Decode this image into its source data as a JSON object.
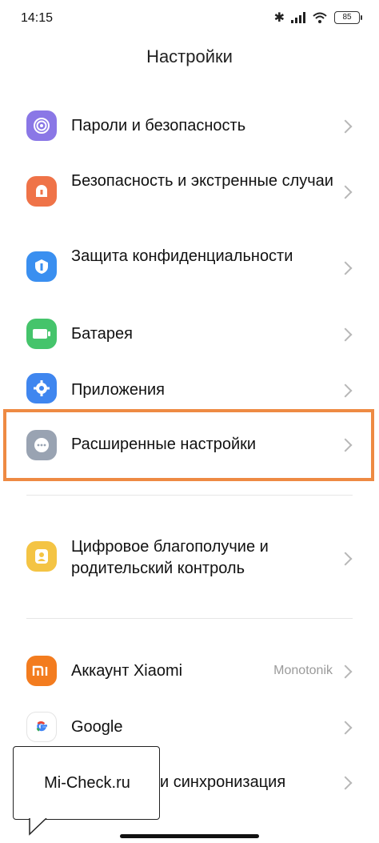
{
  "status_bar": {
    "time": "14:15",
    "battery": "85"
  },
  "title": "Настройки",
  "items": [
    {
      "label": "Пароли и безопасность",
      "icon": "fingerprint-icon",
      "color": "#8a77e6"
    },
    {
      "label": "Безопасность и экстренные случаи",
      "icon": "emergency-icon",
      "color": "#ef7348"
    },
    {
      "label": "Защита конфиденциальности",
      "icon": "privacy-shield-icon",
      "color": "#3a8ff0"
    },
    {
      "label": "Батарея",
      "icon": "battery-icon",
      "color": "#45c46b"
    },
    {
      "label": "Приложения",
      "icon": "gear-icon",
      "color": "#3f86ef"
    },
    {
      "label": "Расширенные настройки",
      "icon": "more-dots-icon",
      "color": "#99a3b2"
    },
    {
      "label": "Цифровое благополучие и родительский контроль",
      "icon": "wellbeing-person-icon",
      "color": "#f4c444"
    },
    {
      "label": "Аккаунт Xiaomi",
      "icon": "xiaomi-logo-icon",
      "color": "#f37c1f",
      "value": "Monotonik"
    },
    {
      "label": "Google",
      "icon": "google-logo-icon",
      "color": "#ffffff"
    },
    {
      "label": "и синхронизация",
      "icon": "sync-icon",
      "color": "#3f86ef"
    }
  ],
  "highlight_color": "#ee8a43",
  "watermark": "Mi-Check.ru"
}
